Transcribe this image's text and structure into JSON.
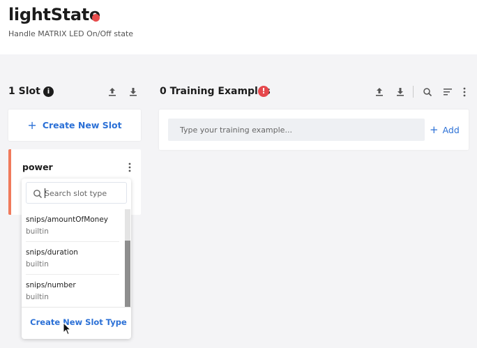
{
  "header": {
    "title": "lightState",
    "subtitle": "Handle MATRIX LED On/Off state",
    "status_color": "#e74c4c"
  },
  "slots": {
    "count_label": "1 Slot",
    "info_icon": "info-icon",
    "create_label": "Create New Slot",
    "items": [
      {
        "name": "power",
        "accent_color": "#f07a5c"
      }
    ]
  },
  "slot_type_dropdown": {
    "search_placeholder": "Search slot type",
    "options": [
      {
        "name": "snips/amountOfMoney",
        "kind": "builtin"
      },
      {
        "name": "snips/duration",
        "kind": "builtin"
      },
      {
        "name": "snips/number",
        "kind": "builtin"
      }
    ],
    "create_label": "Create New Slot Type"
  },
  "training": {
    "title": "0 Training Examples",
    "warning_icon": "alert-icon",
    "input_placeholder": "Type your training example...",
    "add_label": "Add"
  },
  "colors": {
    "accent": "#2b70d6",
    "warning": "#e5484d"
  }
}
